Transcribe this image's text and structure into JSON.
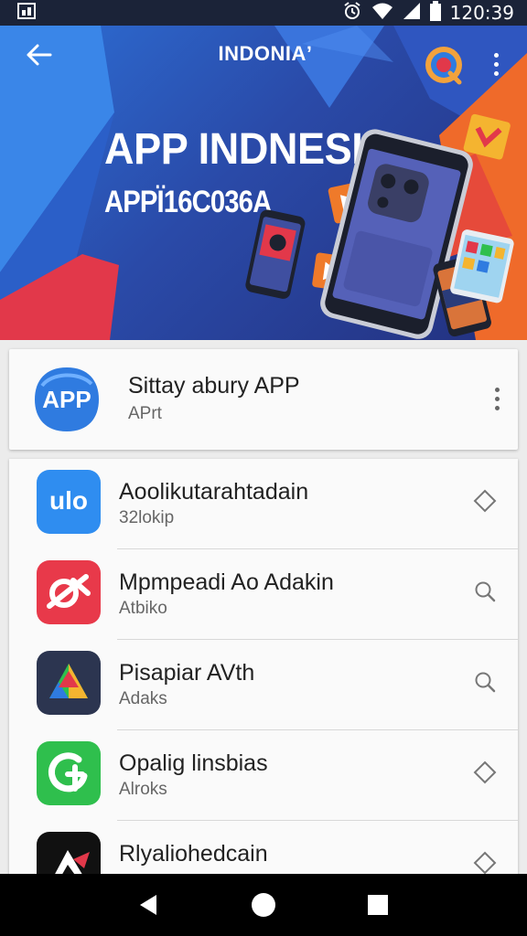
{
  "status_bar": {
    "time": "120:39",
    "icons": [
      "notification-icon",
      "alarm-icon",
      "wifi-icon",
      "signal-icon",
      "battery-icon"
    ]
  },
  "hero": {
    "brand": "INDONIAʼ",
    "headline": "APP INDNESIA",
    "subheadline": "APPÏ16C036A",
    "colors": {
      "blue": "#2d6fd6",
      "navy": "#23307e",
      "orange": "#ef6a2a",
      "red": "#e2384a"
    }
  },
  "featured_app": {
    "icon_text": "APP",
    "name": "Sittay abury APP",
    "subtitle": "APrt"
  },
  "apps": [
    {
      "icon_text": "ulo",
      "title": "Aoolikutarahtadain",
      "subtitle": "32lokip",
      "action": "diamond-icon",
      "icon_color": "#2f8df0"
    },
    {
      "icon_text": "",
      "title": "Mpmpeadi Ao Adakin",
      "subtitle": "Atbiko",
      "action": "search-icon",
      "icon_color": "#e8394a"
    },
    {
      "icon_text": "",
      "title": "Pisapiar AVth",
      "subtitle": "Adaks",
      "action": "search-icon",
      "icon_color": "#2c3550"
    },
    {
      "icon_text": "",
      "title": "Opalig linsbias",
      "subtitle": "Alroks",
      "action": "diamond-icon",
      "icon_color": "#2fbf4d"
    },
    {
      "icon_text": "",
      "title": "Rlyaliohedcain",
      "subtitle": "",
      "action": "diamond-icon",
      "icon_color": "#111111"
    }
  ]
}
